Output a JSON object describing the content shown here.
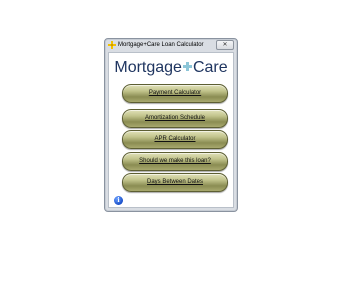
{
  "window": {
    "title": "Mortgage+Care Loan Calculator",
    "close_glyph": "✕"
  },
  "brand": {
    "left": "Mortgage",
    "right": "Care"
  },
  "menu": [
    {
      "label": "Payment Calculator"
    },
    {
      "label": "Amortization Schedule"
    },
    {
      "label": "APR Calculator"
    },
    {
      "label": "Should we make this loan?"
    },
    {
      "label": "Days Between Dates"
    }
  ],
  "icons": {
    "app": "plus-cross-icon",
    "info": "info-icon",
    "info_glyph": "i"
  },
  "colors": {
    "brand_text": "#1f3560",
    "brand_plus": "#8dc6d8",
    "button_olive": "#a8a96e",
    "app_icon": "#f2c200"
  }
}
